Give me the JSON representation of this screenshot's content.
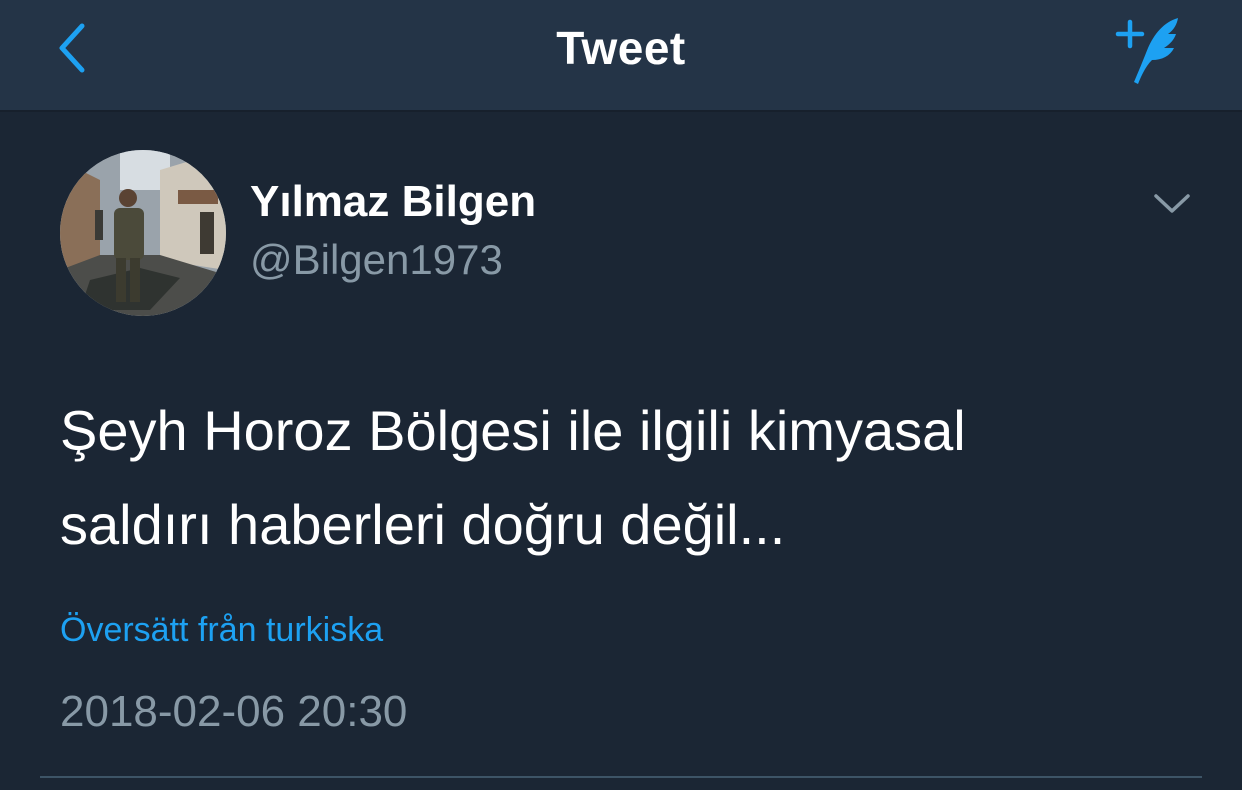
{
  "navbar": {
    "title": "Tweet",
    "back_icon": "chevron-left-icon",
    "compose_icon": "compose-tweet-icon"
  },
  "tweet": {
    "author": {
      "display_name": "Yılmaz Bilgen",
      "handle": "@Bilgen1973",
      "avatar": "profile-photo"
    },
    "text": "Şeyh Horoz Bölgesi ile ilgili kimyasal\nsaldırı haberleri doğru değil...",
    "translate_label": "Översätt från turkiska",
    "timestamp": "2018-02-06 20:30",
    "more_icon": "chevron-down-icon"
  },
  "colors": {
    "background": "#1b2634",
    "navbar": "#243447",
    "accent": "#1da1f2",
    "secondary_text": "#8899a6",
    "primary_text": "#ffffff"
  }
}
